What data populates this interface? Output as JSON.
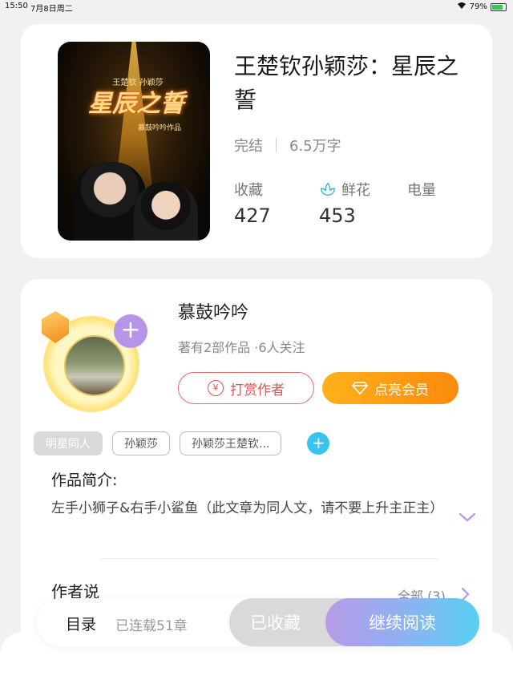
{
  "status_bar": {
    "time": "15:50",
    "date": "7月8日周二",
    "battery": "79%",
    "battery_level": 0.79
  },
  "book": {
    "title": "王楚钦孙颖莎：星辰之誓",
    "status": "完结",
    "word_count": "6.5万字",
    "cover": {
      "title": "星辰之誓",
      "subtitle": "王楚钦 孙颖莎",
      "author_note": "慕鼓吟吟作品"
    },
    "stats": [
      {
        "label": "收藏",
        "value": "427",
        "icon": null
      },
      {
        "label": "鲜花",
        "value": "453",
        "icon": "flower-icon"
      },
      {
        "label": "电量",
        "value": "",
        "icon": null
      }
    ]
  },
  "author": {
    "name": "慕鼓吟吟",
    "stats": "著有2部作品 ·6人关注",
    "reward_label": "打赏作者",
    "vip_label": "点亮会员",
    "follow_symbol": "+"
  },
  "tags": [
    "明星同人",
    "孙颖莎",
    "孙颖莎王楚钦..."
  ],
  "tag_add_symbol": "+",
  "intro": {
    "label": "作品简介:",
    "text": "左手小狮子&右手小鲨鱼（此文章为同人文，请不要上升主正主）"
  },
  "author_said": {
    "label": "作者说",
    "all": "全部 (3)"
  },
  "bottom_bar": {
    "toc": "目录",
    "chapters": "已连载51章",
    "collected": "已收藏",
    "continue": "继续阅读"
  },
  "colors": {
    "accent_red": "#e25353",
    "accent_orange": "#fb8a0c",
    "accent_blue": "#38c4ef",
    "accent_purple": "#b695e8"
  }
}
